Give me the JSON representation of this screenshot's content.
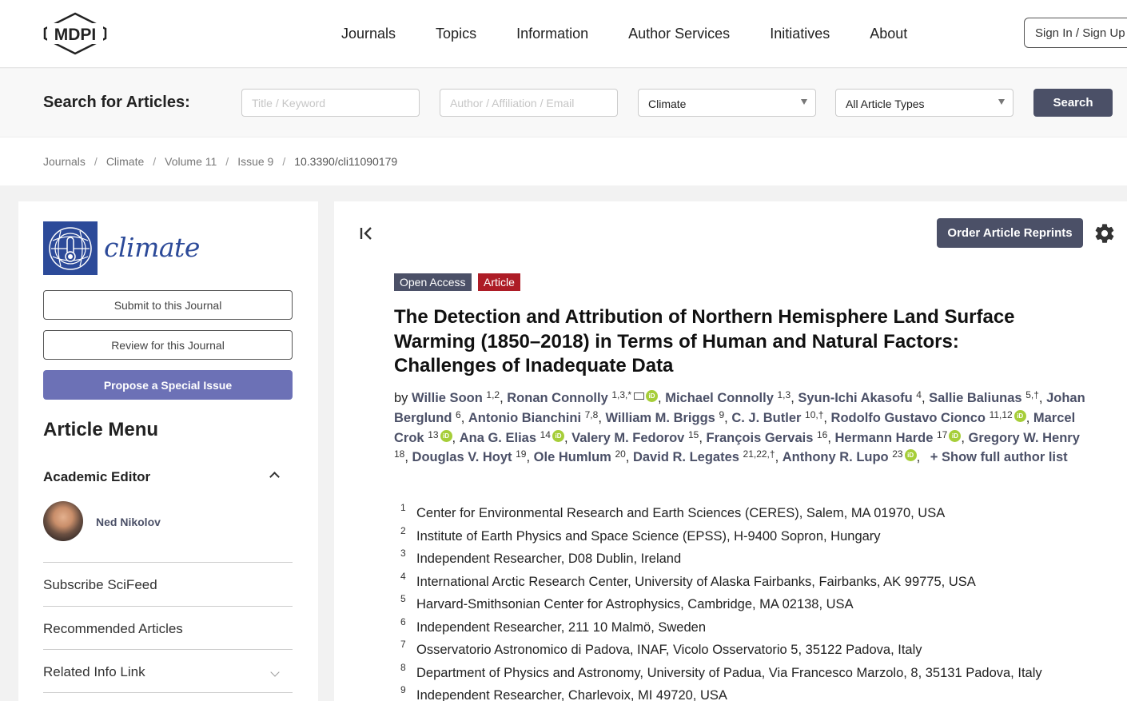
{
  "header": {
    "brand": "MDPI",
    "nav": [
      "Journals",
      "Topics",
      "Information",
      "Author Services",
      "Initiatives",
      "About"
    ],
    "signin": "Sign In / Sign Up"
  },
  "search": {
    "label": "Search for Articles:",
    "title_placeholder": "Title / Keyword",
    "author_placeholder": "Author / Affiliation / Email",
    "journal_value": "Climate",
    "type_value": "All Article Types",
    "button": "Search"
  },
  "breadcrumb": [
    "Journals",
    "Climate",
    "Volume 11",
    "Issue 9",
    "10.3390/cli11090179"
  ],
  "sidebar": {
    "journal_name": "climate",
    "submit": "Submit to this Journal",
    "review": "Review for this Journal",
    "propose": "Propose a Special Issue",
    "article_menu": "Article Menu",
    "academic_editor": "Academic Editor",
    "editor_name": "Ned Nikolov",
    "items": [
      "Subscribe SciFeed",
      "Recommended Articles",
      "Related Info Link"
    ]
  },
  "article": {
    "reprint_button": "Order Article Reprints",
    "badge_access": "Open Access",
    "badge_type": "Article",
    "title": "The Detection and Attribution of Northern Hemisphere Land Surface Warming (1850–2018) in Terms of Human and Natural Factors: Challenges of Inadequate Data",
    "by": "by",
    "show_full": "Show full author list",
    "authors": [
      {
        "name": "Willie Soon",
        "sup": "1,2"
      },
      {
        "name": "Ronan Connolly",
        "sup": "1,3,*"
      },
      {
        "name": "Michael Connolly",
        "sup": "1,3"
      },
      {
        "name": "Syun-Ichi Akasofu",
        "sup": "4"
      },
      {
        "name": "Sallie Baliunas",
        "sup": "5,†"
      },
      {
        "name": "Johan Berglund",
        "sup": "6"
      },
      {
        "name": "Antonio Bianchini",
        "sup": "7,8"
      },
      {
        "name": "William M. Briggs",
        "sup": "9"
      },
      {
        "name": "C. J. Butler",
        "sup": "10,†"
      },
      {
        "name": "Rodolfo Gustavo Cionco",
        "sup": "11,12"
      },
      {
        "name": "Marcel Crok",
        "sup": "13"
      },
      {
        "name": "Ana G. Elias",
        "sup": "14"
      },
      {
        "name": "Valery M. Fedorov",
        "sup": "15"
      },
      {
        "name": "François Gervais",
        "sup": "16"
      },
      {
        "name": "Hermann Harde",
        "sup": "17"
      },
      {
        "name": "Gregory W. Henry",
        "sup": "18"
      },
      {
        "name": "Douglas V. Hoyt",
        "sup": "19"
      },
      {
        "name": "Ole Humlum",
        "sup": "20"
      },
      {
        "name": "David R. Legates",
        "sup": "21,22,†"
      },
      {
        "name": "Anthony R. Lupo",
        "sup": "23"
      }
    ],
    "affiliations": [
      {
        "num": "1",
        "text": "Center for Environmental Research and Earth Sciences (CERES), Salem, MA 01970, USA"
      },
      {
        "num": "2",
        "text": "Institute of Earth Physics and Space Science (EPSS), H-9400 Sopron, Hungary"
      },
      {
        "num": "3",
        "text": "Independent Researcher, D08 Dublin, Ireland"
      },
      {
        "num": "4",
        "text": "International Arctic Research Center, University of Alaska Fairbanks, Fairbanks, AK 99775, USA"
      },
      {
        "num": "5",
        "text": "Harvard-Smithsonian Center for Astrophysics, Cambridge, MA 02138, USA"
      },
      {
        "num": "6",
        "text": "Independent Researcher, 211 10 Malmö, Sweden"
      },
      {
        "num": "7",
        "text": "Osservatorio Astronomico di Padova, INAF, Vicolo Osservatorio 5, 35122 Padova, Italy"
      },
      {
        "num": "8",
        "text": "Department of Physics and Astronomy, University of Padua, Via Francesco Marzolo, 8, 35131 Padova, Italy"
      },
      {
        "num": "9",
        "text": "Independent Researcher, Charlevoix, MI 49720, USA"
      }
    ]
  }
}
